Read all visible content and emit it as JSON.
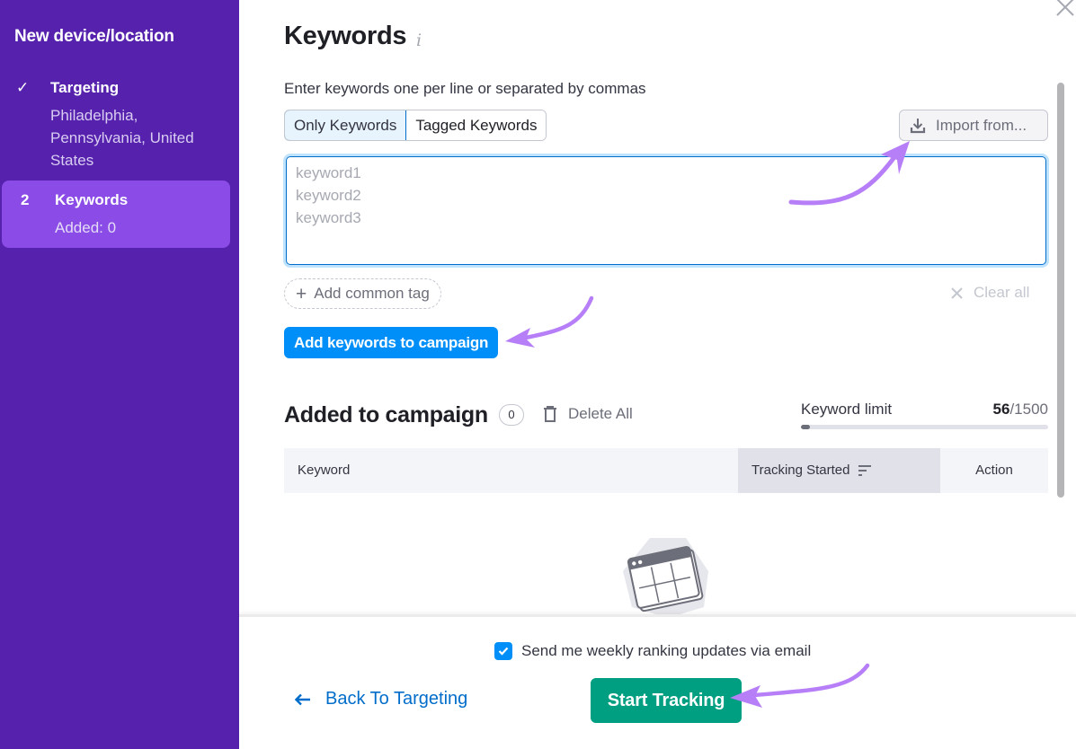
{
  "sidebar": {
    "title": "New device/location",
    "steps": [
      {
        "marker": "✓",
        "name": "Targeting",
        "subtitle": "Philadelphia, Pennsylvania, United States",
        "status": "completed"
      },
      {
        "marker": "2",
        "name": "Keywords",
        "subtitle": "Added: 0",
        "status": "active"
      }
    ]
  },
  "main": {
    "title": "Keywords",
    "info_icon": "i",
    "instructions": "Enter keywords one per line or separated by commas",
    "mode_tabs": [
      {
        "label": "Only Keywords",
        "active": true
      },
      {
        "label": "Tagged Keywords",
        "active": false
      }
    ],
    "import_button": "Import from...",
    "keywords_input": {
      "value": "",
      "placeholder": "keyword1\nkeyword2\nkeyword3"
    },
    "add_common_tag": "Add common tag",
    "clear_all": "Clear all",
    "add_keywords_button": "Add keywords to campaign",
    "added_section": {
      "title": "Added to campaign",
      "count": "0",
      "delete_all": "Delete All"
    },
    "keyword_limit": {
      "label": "Keyword limit",
      "used": "56",
      "total": "/1500",
      "fraction": 0.0373
    },
    "table": {
      "columns": [
        "Keyword",
        "Tracking Started",
        "Action"
      ],
      "rows": []
    }
  },
  "footer": {
    "email_checkbox": {
      "label": "Send me weekly ranking updates via email",
      "checked": true
    },
    "back_link": "Back To Targeting",
    "start_button": "Start Tracking"
  },
  "colors": {
    "sidebar_bg": "#5622ad",
    "active_step_bg": "#8a4be6",
    "primary_blue": "#008ff8",
    "link_blue": "#006dca",
    "start_green": "#009f81",
    "annotation_arrow": "#b77ff7"
  }
}
